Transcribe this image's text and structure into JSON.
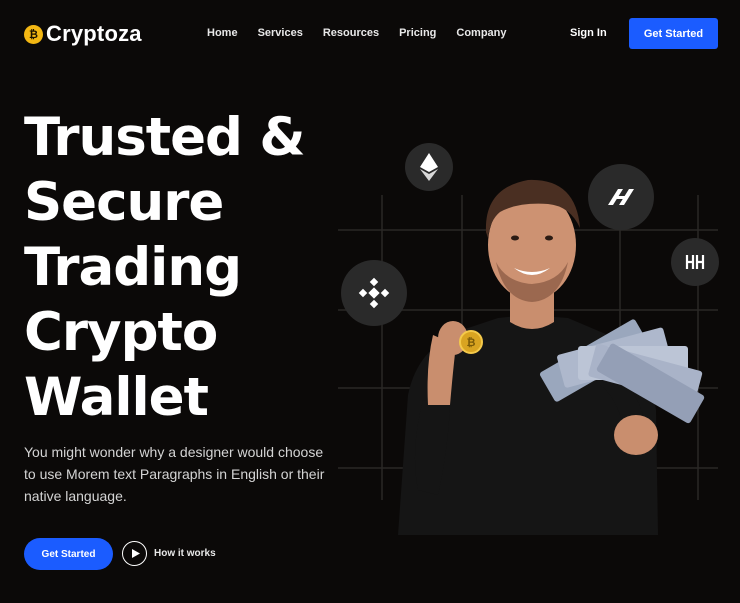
{
  "brand": {
    "name": "Cryptoza",
    "logo_glyph": "₿",
    "logo_color": "#f3b713"
  },
  "nav": {
    "items": [
      "Home",
      "Services",
      "Resources",
      "Pricing",
      "Company"
    ],
    "sign_in": "Sign In",
    "get_started": "Get Started"
  },
  "hero": {
    "title_lines": [
      "Trusted &",
      "Secure",
      "Trading",
      "Crypto",
      "Wallet"
    ],
    "description": "You might wonder why a designer would choose to use Morem text Paragraphs in English or their native language.",
    "cta_label": "Get Started",
    "secondary_label": "How it works"
  },
  "visual": {
    "coin_icons": [
      "ethereum-icon",
      "binance-icon",
      "hive-icon",
      "harmony-icon"
    ],
    "photo": "smiling-man-with-bitcoin-and-cash"
  },
  "colors": {
    "accent": "#1b5cff",
    "background": "#0b0908",
    "badge": "#2a2a2a"
  }
}
